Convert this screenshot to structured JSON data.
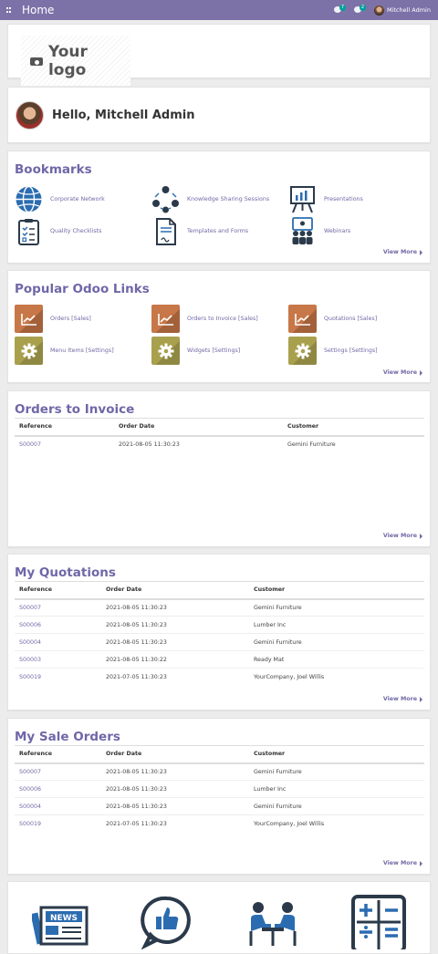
{
  "topbar": {
    "title": "Home",
    "messages_count": "7",
    "activities_count": "2",
    "user_name": "Mitchell Admin",
    "bg_color": "#7d72a8"
  },
  "logo": {
    "text": "Your logo"
  },
  "greeting": {
    "text": "Hello, Mitchell Admin"
  },
  "bookmarks": {
    "title": "Bookmarks",
    "items": [
      {
        "label": "Corporate Network",
        "icon": "globe-icon"
      },
      {
        "label": "Knowledge Sharing Sessions",
        "icon": "network-icon"
      },
      {
        "label": "Presentations",
        "icon": "presentation-board-icon"
      },
      {
        "label": "Quality Checklists",
        "icon": "checklist-icon"
      },
      {
        "label": "Templates and Forms",
        "icon": "document-icon"
      },
      {
        "label": "Webinars",
        "icon": "webinar-icon"
      }
    ],
    "view_more": "View More"
  },
  "popular_links": {
    "title": "Popular Odoo Links",
    "items": [
      {
        "label": "Orders [Sales]",
        "icon": "sales-chart-icon"
      },
      {
        "label": "Orders to Invoice [Sales]",
        "icon": "sales-chart-icon"
      },
      {
        "label": "Quotations [Sales]",
        "icon": "sales-chart-icon"
      },
      {
        "label": "Menu Items [Settings]",
        "icon": "settings-gear-icon"
      },
      {
        "label": "Widgets [Settings]",
        "icon": "settings-gear-icon"
      },
      {
        "label": "Settings [Settings]",
        "icon": "settings-gear-icon"
      }
    ],
    "view_more": "View More"
  },
  "orders_to_invoice": {
    "title": "Orders to Invoice",
    "columns": [
      "Reference",
      "Order Date",
      "Customer"
    ],
    "rows": [
      [
        "S00007",
        "2021-08-05 11:30:23",
        "Gemini Furniture"
      ]
    ],
    "view_more": "View More"
  },
  "my_quotations": {
    "title": "My Quotations",
    "columns": [
      "Reference",
      "Order Date",
      "Customer"
    ],
    "rows": [
      [
        "S00007",
        "2021-08-05 11:30:23",
        "Gemini Furniture"
      ],
      [
        "S00006",
        "2021-08-05 11:30:23",
        "Lumber Inc"
      ],
      [
        "S00004",
        "2021-08-05 11:30:23",
        "Gemini Furniture"
      ],
      [
        "S00003",
        "2021-08-05 11:30:22",
        "Ready Mat"
      ],
      [
        "S00019",
        "2021-07-05 11:30:23",
        "YourCompany, Joel Willis"
      ]
    ],
    "view_more": "View More"
  },
  "my_sale_orders": {
    "title": "My Sale Orders",
    "columns": [
      "Reference",
      "Order Date",
      "Customer"
    ],
    "rows": [
      [
        "S00007",
        "2021-08-05 11:30:23",
        "Gemini Furniture"
      ],
      [
        "S00006",
        "2021-08-05 11:30:23",
        "Lumber Inc"
      ],
      [
        "S00004",
        "2021-08-05 11:30:23",
        "Gemini Furniture"
      ],
      [
        "S00019",
        "2021-07-05 11:30:23",
        "YourCompany, Joel Willis"
      ]
    ],
    "view_more": "View More"
  },
  "bottom_icons": [
    "news-icon",
    "thumbs-up-chat-icon",
    "meeting-icon",
    "calculator-icon"
  ],
  "colors": {
    "accent": "#7069a6",
    "icon_blue": "#2b6cb0",
    "icon_dark": "#334155"
  }
}
